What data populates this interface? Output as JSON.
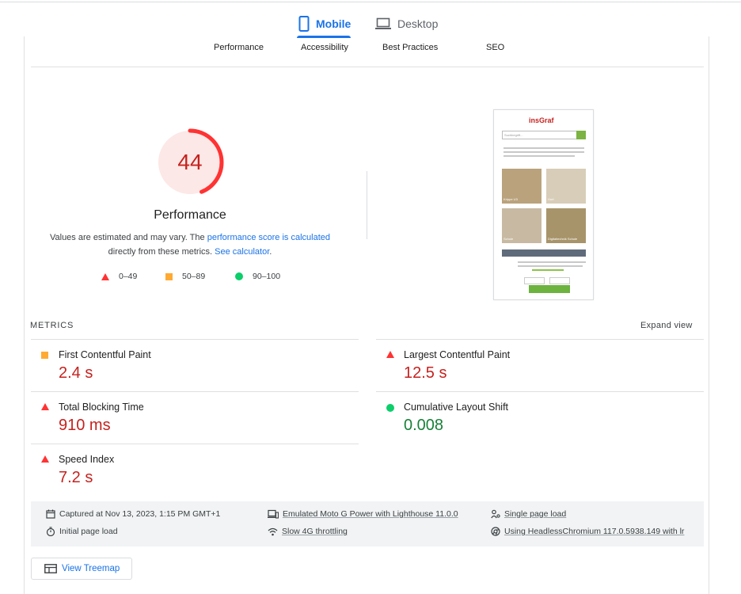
{
  "device_tabs": [
    {
      "label": "Mobile",
      "icon": "smartphone-icon",
      "active": true
    },
    {
      "label": "Desktop",
      "icon": "laptop-icon",
      "active": false
    }
  ],
  "category_tabs": [
    "Performance",
    "Accessibility",
    "Best Practices",
    "SEO"
  ],
  "gauge": {
    "score": "44",
    "score_value": 44,
    "title": "Performance",
    "desc_1": "Values are estimated and may vary. The ",
    "desc_link": "performance score is calculated",
    "desc_2": "directly from these metrics. ",
    "desc_link2": "See calculator",
    "desc_end": "."
  },
  "legend": [
    {
      "shape": "triangle",
      "label": "0–49",
      "color": "#ff3333"
    },
    {
      "shape": "square",
      "label": "50–89",
      "color": "#ffaa33"
    },
    {
      "shape": "circle",
      "label": "90–100",
      "color": "#0cce6b"
    }
  ],
  "thumbnail": {
    "logo": "insGraf",
    "search_placeholder": "Suchbegriff...",
    "tiles": [
      "Krippe U3",
      "Hort",
      "Schule",
      "Digitaltechnik Schule"
    ]
  },
  "metrics": {
    "label": "METRICS",
    "expand": "Expand view",
    "items": [
      {
        "title": "First Contentful Paint",
        "value": "2.4 s",
        "rating": "average"
      },
      {
        "title": "Largest Contentful Paint",
        "value": "12.5 s",
        "rating": "fail"
      },
      {
        "title": "Total Blocking Time",
        "value": "910 ms",
        "rating": "fail"
      },
      {
        "title": "Cumulative Layout Shift",
        "value": "0.008",
        "rating": "pass"
      },
      {
        "title": "Speed Index",
        "value": "7.2 s",
        "rating": "fail"
      }
    ]
  },
  "info": {
    "captured": "Captured at Nov 13, 2023, 1:15 PM GMT+1",
    "initial": "Initial page load",
    "emulated": "Emulated Moto G Power with Lighthouse 11.0.0",
    "throttling": "Slow 4G throttling",
    "single": "Single page load",
    "browser": "Using HeadlessChromium 117.0.5938.149 with lr"
  },
  "treemap": "View Treemap",
  "colors": {
    "accent": "#1a73e8",
    "fail": "#ff3333",
    "average": "#ffaa33",
    "pass": "#0cce6b"
  }
}
